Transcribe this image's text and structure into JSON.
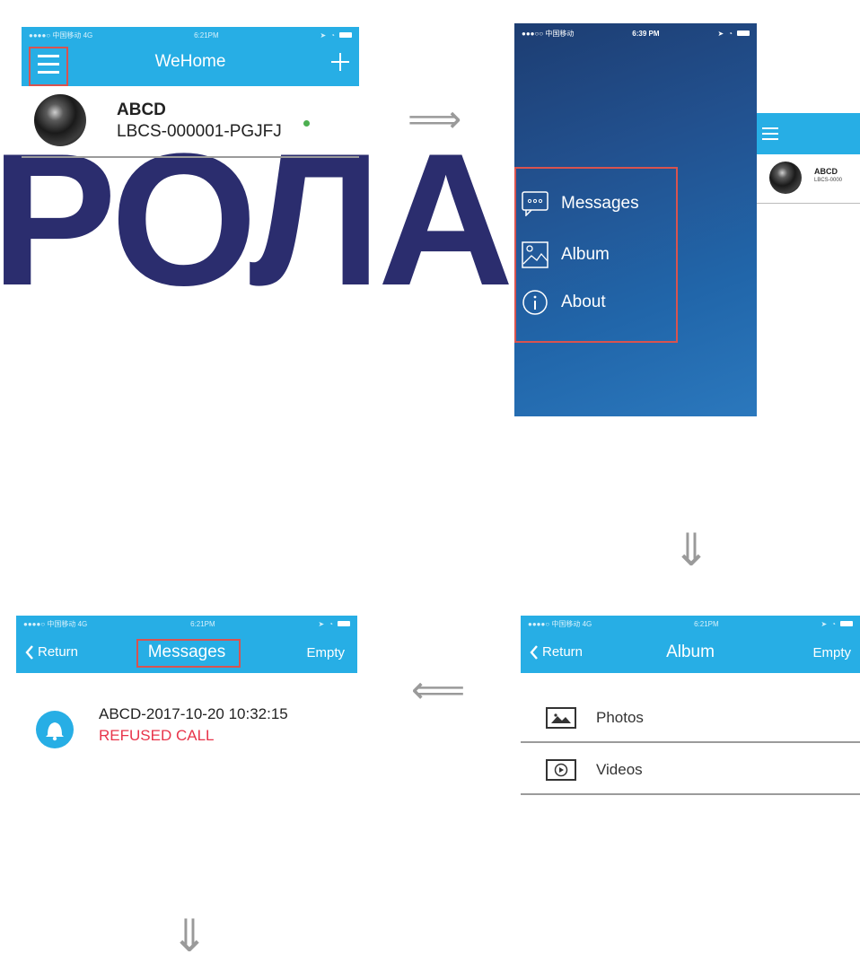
{
  "watermark": "РОЛАЙ",
  "screen1": {
    "status": {
      "carrier": "●●●●○ 中国移动 4G",
      "time": "6:21PM"
    },
    "title": "WeHome",
    "device": {
      "name": "ABCD",
      "id": "LBCS-000001-PGJFJ"
    }
  },
  "screen2": {
    "status": {
      "carrier": "●●●○○ 中国移动",
      "time": "6:39 PM"
    },
    "menu": {
      "messages": "Messages",
      "album": "Album",
      "about": "About"
    },
    "peek": {
      "name": "ABCD",
      "id": "LBCS-0000"
    }
  },
  "screen3": {
    "status": {
      "carrier": "●●●●○ 中国移动 4G",
      "time": "6:21PM"
    },
    "back": "Return",
    "title": "Album",
    "action": "Empty",
    "items": {
      "photos": "Photos",
      "videos": "Videos"
    }
  },
  "screen4": {
    "status": {
      "carrier": "●●●●○ 中国移动 4G",
      "time": "6:21PM"
    },
    "back": "Return",
    "title": "Messages",
    "action": "Empty",
    "message": {
      "title": "ABCD-2017-10-20 10:32:15",
      "status": "REFUSED CALL"
    }
  },
  "arrows": {
    "right": "⟹",
    "down": "⇓",
    "left": "⟸"
  },
  "colors": {
    "accent": "#27aee5",
    "highlight": "#d9534f",
    "alert": "#e8344a",
    "online": "#4caf50"
  }
}
